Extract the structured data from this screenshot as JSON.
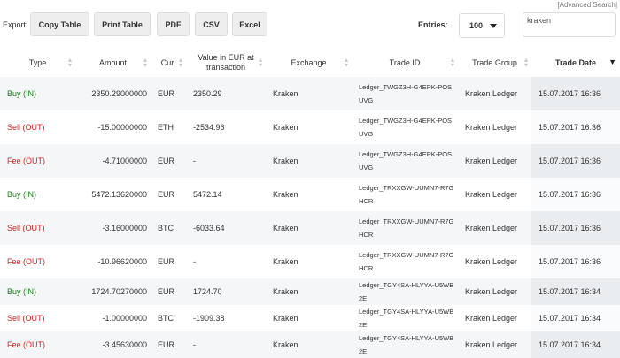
{
  "advanced_search": "[Advanced Search]",
  "toolbar": {
    "export_label": "Export:",
    "buttons": [
      "Copy Table",
      "Print Table",
      "PDF",
      "CSV",
      "Excel"
    ],
    "entries_label": "Entries:",
    "entries_value": "100",
    "search_value": "kraken"
  },
  "table": {
    "headers": [
      "Type",
      "Amount",
      "Cur.",
      "Value in EUR at transaction",
      "Exchange",
      "Trade ID",
      "Trade Group",
      "Trade Date"
    ],
    "rows": [
      {
        "type": "Buy (IN)",
        "dir": "in",
        "amount": "2350.29000000",
        "cur": "EUR",
        "value": "2350.29",
        "exchange": "Kraken",
        "trade_id": "Ledger_TWGZ3H-G4EPK-POSUVG",
        "group": "Kraken Ledger",
        "date": "15.07.2017 16:36"
      },
      {
        "type": "Sell (OUT)",
        "dir": "out",
        "amount": "-15.00000000",
        "cur": "ETH",
        "value": "-2534.96",
        "exchange": "Kraken",
        "trade_id": "Ledger_TWGZ3H-G4EPK-POSUVG",
        "group": "Kraken Ledger",
        "date": "15.07.2017 16:36"
      },
      {
        "type": "Fee (OUT)",
        "dir": "out",
        "amount": "-4.71000000",
        "cur": "EUR",
        "value": "-",
        "exchange": "Kraken",
        "trade_id": "Ledger_TWGZ3H-G4EPK-POSUVG",
        "group": "Kraken Ledger",
        "date": "15.07.2017 16:36"
      },
      {
        "type": "Buy (IN)",
        "dir": "in",
        "amount": "5472.13620000",
        "cur": "EUR",
        "value": "5472.14",
        "exchange": "Kraken",
        "trade_id": "Ledger_TRXXGW-UUMN7-R7GHCR",
        "group": "Kraken Ledger",
        "date": "15.07.2017 16:36"
      },
      {
        "type": "Sell (OUT)",
        "dir": "out",
        "amount": "-3.16000000",
        "cur": "BTC",
        "value": "-6033.64",
        "exchange": "Kraken",
        "trade_id": "Ledger_TRXXGW-UUMN7-R7GHCR",
        "group": "Kraken Ledger",
        "date": "15.07.2017 16:36"
      },
      {
        "type": "Fee (OUT)",
        "dir": "out",
        "amount": "-10.96620000",
        "cur": "EUR",
        "value": "-",
        "exchange": "Kraken",
        "trade_id": "Ledger_TRXXGW-UUMN7-R7GHCR",
        "group": "Kraken Ledger",
        "date": "15.07.2017 16:36"
      },
      {
        "type": "Buy (IN)",
        "dir": "in",
        "amount": "1724.70270000",
        "cur": "EUR",
        "value": "1724.70",
        "exchange": "Kraken",
        "trade_id": "Ledger_TGY4SA-HLYYA-U5WB2E",
        "group": "Kraken Ledger",
        "date": "15.07.2017 16:34"
      },
      {
        "type": "Sell (OUT)",
        "dir": "out",
        "amount": "-1.00000000",
        "cur": "BTC",
        "value": "-1909.38",
        "exchange": "Kraken",
        "trade_id": "Ledger_TGY4SA-HLYYA-U5WB2E",
        "group": "Kraken Ledger",
        "date": "15.07.2017 16:34"
      },
      {
        "type": "Fee (OUT)",
        "dir": "out",
        "amount": "-3.45630000",
        "cur": "EUR",
        "value": "-",
        "exchange": "Kraken",
        "trade_id": "Ledger_TGY4SA-HLYYA-U5WB2E",
        "group": "Kraken Ledger",
        "date": "15.07.2017 16:34"
      }
    ]
  },
  "colors": {
    "in": "#1a7f1a",
    "out": "#d42121",
    "row_stripe": "#f4f6f8"
  }
}
